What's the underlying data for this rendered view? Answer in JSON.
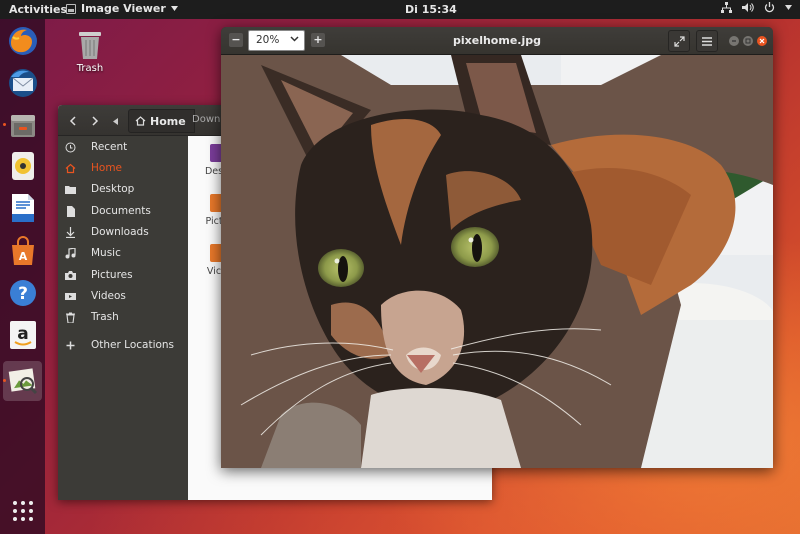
{
  "topbar": {
    "activities": "Activities",
    "app_menu": "Image Viewer",
    "clock": "Di 15:34"
  },
  "dock": {
    "items": [
      "firefox-icon",
      "thunderbird-icon",
      "files-icon",
      "rhythmbox-icon",
      "libreoffice-writer-icon",
      "software-center-icon",
      "help-icon",
      "amazon-icon",
      "image-viewer-icon"
    ],
    "show_apps": "app-grid-icon"
  },
  "desktop": {
    "trash_label": "Trash"
  },
  "files": {
    "breadcrumb_home": "Home",
    "breadcrumb_next": "Downl",
    "sidebar": [
      {
        "label": "Recent",
        "icon": "clock-icon"
      },
      {
        "label": "Home",
        "icon": "home-icon"
      },
      {
        "label": "Desktop",
        "icon": "folder-icon"
      },
      {
        "label": "Documents",
        "icon": "document-icon"
      },
      {
        "label": "Downloads",
        "icon": "download-icon"
      },
      {
        "label": "Music",
        "icon": "music-icon"
      },
      {
        "label": "Pictures",
        "icon": "camera-icon"
      },
      {
        "label": "Videos",
        "icon": "video-icon"
      },
      {
        "label": "Trash",
        "icon": "trash-icon"
      },
      {
        "label": "Other Locations",
        "icon": "plus-icon"
      }
    ],
    "folders": [
      {
        "label": "Des"
      },
      {
        "label": "Pict"
      },
      {
        "label": "Vic"
      }
    ]
  },
  "viewer": {
    "title": "pixelhome.jpg",
    "zoom_value": "20%",
    "zoom_minus": "−",
    "zoom_plus": "+"
  },
  "colors": {
    "accent": "#e95420",
    "panel": "#1d1d1d",
    "sidebar": "#3c3b37"
  }
}
